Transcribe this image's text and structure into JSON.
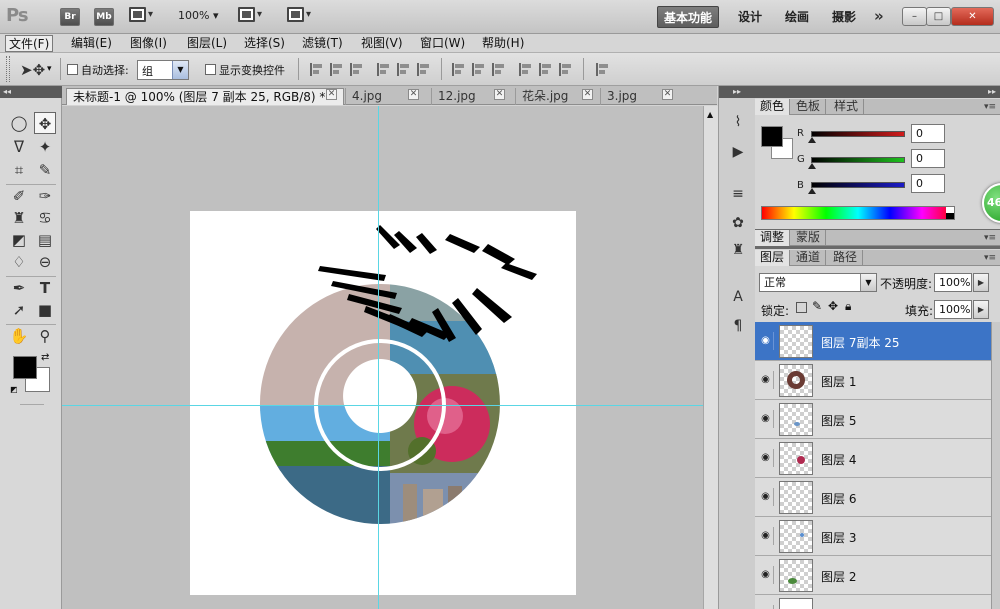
{
  "app": {
    "logo": "Ps",
    "bridge": "Br",
    "minibridge": "Mb",
    "zoom": "100%",
    "workspaces": [
      "基本功能",
      "设计",
      "绘画",
      "摄影"
    ],
    "more": "»"
  },
  "window": {
    "minimize": "–",
    "restore": "□",
    "close": "✕"
  },
  "menu": [
    "文件(F)",
    "编辑(E)",
    "图像(I)",
    "图层(L)",
    "选择(S)",
    "滤镜(T)",
    "视图(V)",
    "窗口(W)",
    "帮助(H)"
  ],
  "options": {
    "auto_select_label": "自动选择:",
    "auto_select_value": "组",
    "show_transform_label": "显示变换控件"
  },
  "tabs": [
    {
      "label": "未标题-1 @ 100% (图层 7 副本 25, RGB/8) *",
      "active": true
    },
    {
      "label": "4.jpg",
      "active": false
    },
    {
      "label": "12.jpg",
      "active": false
    },
    {
      "label": "花朵.jpg",
      "active": false
    },
    {
      "label": "3.jpg",
      "active": false
    }
  ],
  "color_panel": {
    "tabs": [
      "颜色",
      "色板",
      "样式"
    ],
    "channels": [
      {
        "label": "R",
        "value": "0",
        "color": "#d11c1c"
      },
      {
        "label": "G",
        "value": "0",
        "color": "#1ec21e"
      },
      {
        "label": "B",
        "value": "0",
        "color": "#1c1cc8"
      }
    ]
  },
  "adjust_panel": {
    "tabs": [
      "调整",
      "蒙版"
    ]
  },
  "layers_panel": {
    "tabs": [
      "图层",
      "通道",
      "路径"
    ],
    "blend_mode": "正常",
    "opacity_label": "不透明度:",
    "opacity": "100%",
    "lock_label": "锁定:",
    "fill_label": "填充:",
    "fill": "100%",
    "layers": [
      {
        "name": "图层 7副本 25",
        "selected": true
      },
      {
        "name": "图层 1",
        "selected": false
      },
      {
        "name": "图层 5",
        "selected": false
      },
      {
        "name": "图层 4",
        "selected": false
      },
      {
        "name": "图层 6",
        "selected": false
      },
      {
        "name": "图层 3",
        "selected": false
      },
      {
        "name": "图层 2",
        "selected": false
      }
    ]
  },
  "badge": "46"
}
